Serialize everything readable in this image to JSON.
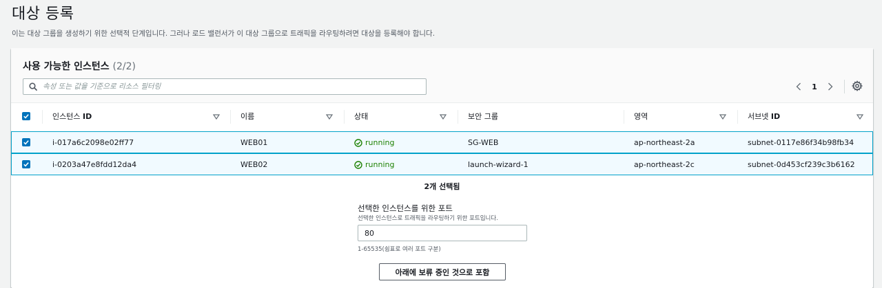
{
  "page": {
    "title": "대상 등록",
    "description": "이는 대상 그룹을 생성하기 위한 선택적 단계입니다. 그러나 로드 밸런서가 이 대상 그룹으로 트래픽을 라우팅하려면 대상을 등록해야 합니다."
  },
  "instances": {
    "title": "사용 가능한 인스턴스",
    "count": "(2/2)",
    "search_placeholder": "속성 또는 값을 기준으로 리소스 필터링",
    "page_number": "1",
    "columns": [
      {
        "prefix": "인스턴스 ",
        "bold": "ID"
      },
      {
        "prefix": "이름",
        "bold": ""
      },
      {
        "prefix": "상태",
        "bold": ""
      },
      {
        "prefix": "보안 그룹",
        "bold": ""
      },
      {
        "prefix": "영역",
        "bold": ""
      },
      {
        "prefix": "서브넷 ",
        "bold": "ID"
      }
    ],
    "rows": [
      {
        "id": "i-017a6c2098e02ff77",
        "name": "WEB01",
        "state": "running",
        "security_group": "SG-WEB",
        "zone": "ap-northeast-2a",
        "subnet": "subnet-0117e86f34b98fb34",
        "checked": true
      },
      {
        "id": "i-0203a47e8fdd12da4",
        "name": "WEB02",
        "state": "running",
        "security_group": "launch-wizard-1",
        "zone": "ap-northeast-2c",
        "subnet": "subnet-0d453cf239c3b6162",
        "checked": true
      }
    ],
    "selected_text": "2개 선택됨"
  },
  "port": {
    "label": "선택한 인스턴스를 위한 포트",
    "description": "선택한 인스턴스로 트래픽을 라우팅하기 위한 포트입니다.",
    "value": "80",
    "hint": "1-65535(쉼표로 여러 포트 구분)",
    "include_button": "아래에 보류 중인 것으로 포함"
  },
  "colors": {
    "primary": "#0073bb",
    "running": "#1d8102",
    "selected_row_bg": "#f1faff",
    "selected_row_border": "#00a1c9"
  }
}
